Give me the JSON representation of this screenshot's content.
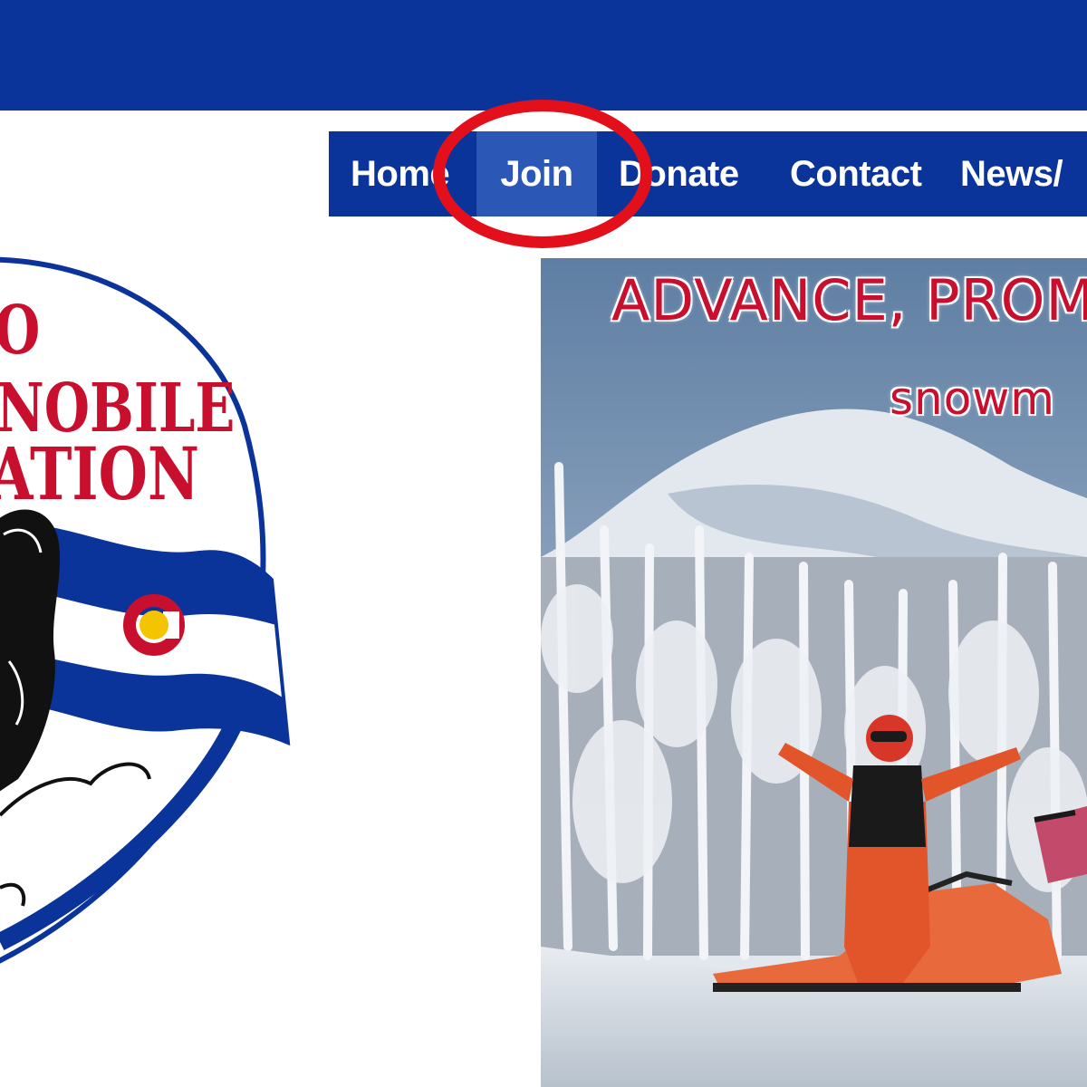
{
  "colors": {
    "brand_blue": "#0a349a",
    "nav_active": "#2b58b6",
    "highlight_red": "#e3101c",
    "logo_red": "#c8102e",
    "flag_yellow": "#f5c400"
  },
  "nav": {
    "items": [
      {
        "label": "Home",
        "active": false
      },
      {
        "label": "Join",
        "active": true
      },
      {
        "label": "Donate",
        "active": false
      },
      {
        "label": "Contact",
        "active": false
      },
      {
        "label": "News/"
      }
    ]
  },
  "logo": {
    "line1": "O",
    "line2": "NOBILE",
    "line3": "ATION"
  },
  "hero": {
    "headline": "ADVANCE, PROM",
    "subline": "snowm"
  }
}
